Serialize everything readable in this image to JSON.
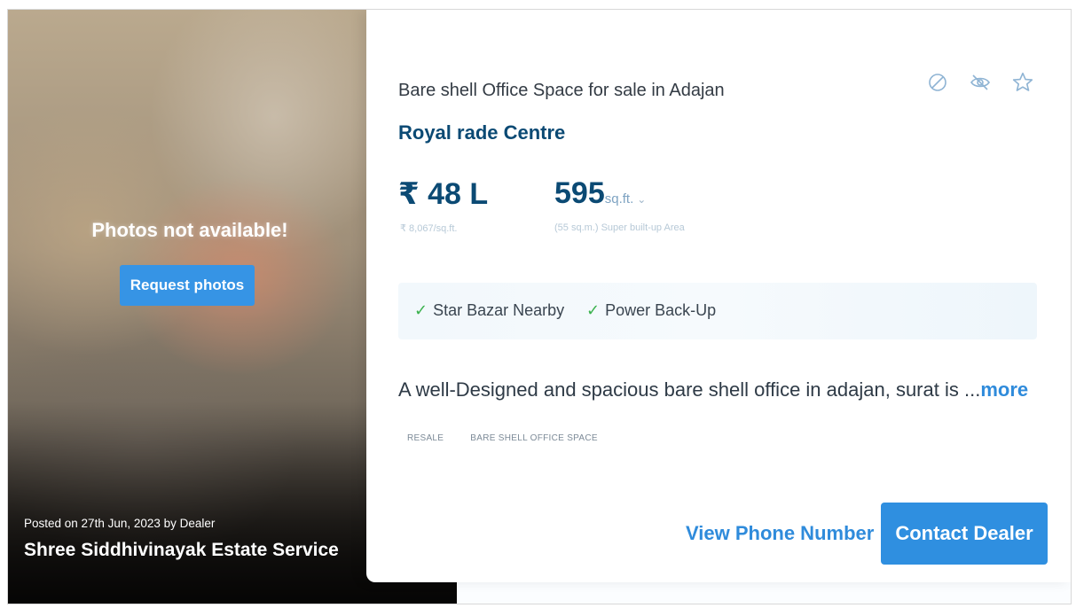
{
  "photo_panel": {
    "message": "Photos not available!",
    "request_button_label": "Request photos",
    "posted_text": "Posted on 27th Jun, 2023 by Dealer",
    "dealer_name": "Shree Siddhivinayak Estate Service"
  },
  "listing": {
    "title": "Bare shell Office Space for sale in Adajan",
    "project_name": "Royal rade Centre",
    "price": "₹ 48 L",
    "price_per_unit": "₹ 8,067/sq.ft.",
    "area_value": "595",
    "area_unit": "sq.ft.",
    "area_chevron": "⌄",
    "area_sub": "(55 sq.m.) Super built-up Area",
    "amenities": [
      {
        "tick": "✓",
        "label": "Star Bazar Nearby"
      },
      {
        "tick": "✓",
        "label": "Power Back-Up"
      }
    ],
    "description": "A well-Designed and spacious bare shell office in adajan, surat is ...",
    "more_label": "more",
    "tags": [
      "RESALE",
      "BARE SHELL OFFICE SPACE"
    ]
  },
  "actions": {
    "view_phone_label": "View Phone Number",
    "contact_label": "Contact Dealer"
  },
  "icons": [
    "not-interested-icon",
    "hide-icon",
    "star-icon"
  ],
  "colors": {
    "accent_blue": "#2f8fe0",
    "title_navy": "#0b4a74",
    "tick_green": "#3bb24e"
  }
}
